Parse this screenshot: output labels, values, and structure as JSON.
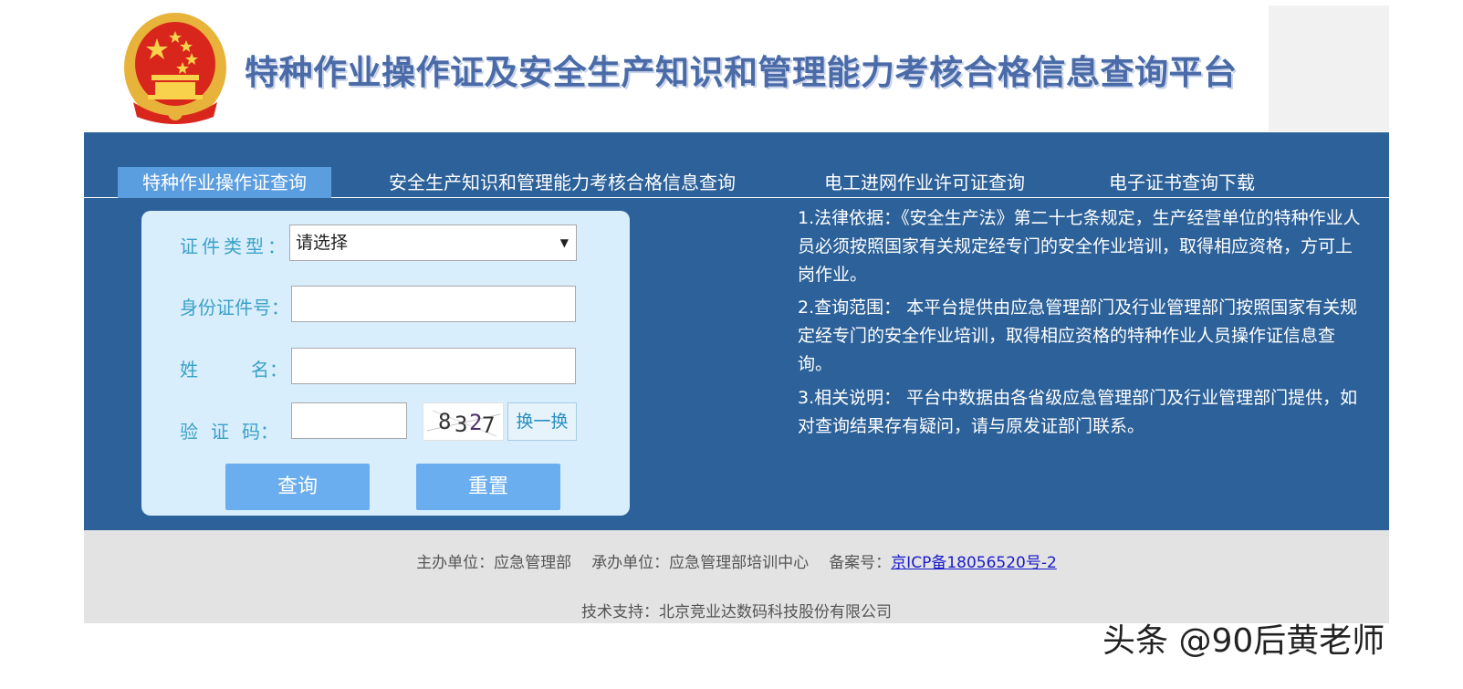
{
  "header": {
    "title": "特种作业操作证及安全生产知识和管理能力考核合格信息查询平台"
  },
  "tabs": [
    {
      "label": "特种作业操作证查询",
      "active": true
    },
    {
      "label": "安全生产知识和管理能力考核合格信息查询",
      "active": false
    },
    {
      "label": "电工进网作业许可证查询",
      "active": false
    },
    {
      "label": "电子证书查询下载",
      "active": false
    }
  ],
  "form": {
    "type_label": "证件类型：",
    "type_value": "请选择",
    "id_label": "身份证件号：",
    "id_value": "",
    "name_label_1": "姓",
    "name_label_2": "名：",
    "name_value": "",
    "code_label_1": "验",
    "code_label_2": "证",
    "code_label_3": "码：",
    "code_value": "",
    "captcha_text": "8327",
    "refresh_label": "换一换",
    "query_label": "查询",
    "reset_label": "重置"
  },
  "info": {
    "item1": "1.法律依据：《安全生产法》第二十七条规定，生产经营单位的特种作业人员必须按照国家有关规定经专门的安全作业培训，取得相应资格，方可上岗作业。",
    "item2": "2.查询范围： 本平台提供由应急管理部门及行业管理部门按照国家有关规定经专门的安全作业培训，取得相应资格的特种作业人员操作证信息查询。",
    "item3": "3.相关说明： 平台中数据由各省级应急管理部门及行业管理部门提供，如对查询结果存有疑问，请与原发证部门联系。"
  },
  "footer": {
    "host": "主办单位：应急管理部",
    "organizer": "承办单位：应急管理部培训中心",
    "icp_label": "备案号：",
    "icp_link": "京ICP备18056520号-2",
    "tech": "技术支持：北京竞业达数码科技股份有限公司"
  },
  "watermark": "头条 @90后黄老师",
  "colors": {
    "band": "#2c6199",
    "active_tab": "#5b9ee0",
    "form_panel": "#d9eefc",
    "button": "#6aaef0",
    "label": "#3aa1c8",
    "footer": "#e3e3e3"
  }
}
